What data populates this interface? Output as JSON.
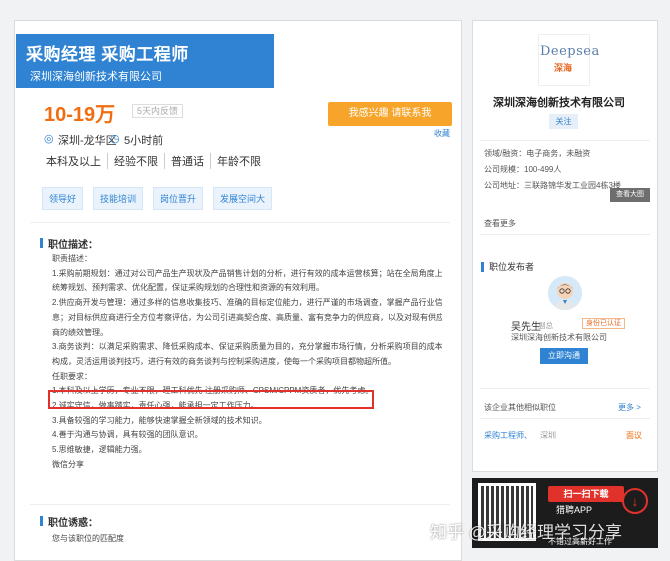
{
  "job": {
    "title": "采购经理 采购工程师",
    "company": "深圳深海创新技术有限公司",
    "salary": "10-19万",
    "feedback": "5天内反馈",
    "interest_button": "我感兴趣 请联系我",
    "collect": "收藏",
    "location": "深圳-龙华区",
    "posted": "5小时前",
    "requirements": [
      "本科及以上",
      "经验不限",
      "普通话",
      "年龄不限"
    ],
    "tags": [
      "领导好",
      "技能培训",
      "岗位晋升",
      "发展空间大"
    ]
  },
  "description": {
    "title": "职位描述：",
    "lines": [
      "职责描述：",
      "1.采购前期规划：通过对公司产品生产现状及产品销售计划的分析，进行有效的成本运营核算；站在全局角度上",
      "统筹规划、预判需求、优化配置，保证采购规划的合理性和资源的有效利用。",
      "2.供应商开发与管理：通过多样的信息收集技巧、准确的目标定位能力，进行严谨的市场调查，掌握产品行业信",
      "息；对目标供应商进行全方位考察评估，为公司引进高契合度、高质量、富有竞争力的供应商，以及对现有供应",
      "商的绩效管理。",
      "3.商务谈判：以满足采购需求、降低采购成本、保证采购质量为目的，充分掌握市场行情，分析采购项目的成本",
      "构成，灵活运用谈判技巧，进行有效的商务谈判与控制采购进度，使每一个采购项目都物超所值。",
      "任职要求：",
      "1.本科及以上学历，专业不限，理工科优先 注册采购师、CPSM/CPPM资质者，优先考虑。",
      "2.诚实守信，做事踏实，责任心强，能承担一定工作压力。",
      "3.具备较强的学习能力，能够快速掌握全新领域的技术知识。",
      "4.善于沟通与协调，具有较强的团队意识。",
      "5.思维敏捷，逻辑能力强。",
      "微信分享"
    ]
  },
  "temptation": {
    "title": "职位诱惑：",
    "text": "您与该职位的匹配度"
  },
  "company_card": {
    "logo_text": "Deepsea",
    "logo_cn": "深海",
    "name": "深圳深海创新技术有限公司",
    "follow": "关注",
    "field": "领域/融资：电子商务，未融资",
    "size": "公司规模：100-499人",
    "address": "公司地址：三联路锦华发工业园4栋3楼",
    "view_map": "查看大图",
    "see_more": "查看更多"
  },
  "publisher": {
    "title": "职位发布者",
    "name": "吴先生",
    "role": "副总",
    "verified": "身份已认证",
    "company": "深圳深海创新技术有限公司",
    "chat_button": "立即沟通"
  },
  "similar": {
    "title": "该企业其他相似职位",
    "more": "更多 >",
    "job": "采购工程师、",
    "city": "深圳",
    "salary": "面议"
  },
  "ad": {
    "scan": "扫一扫下载",
    "app": "猎聘APP",
    "slogan": "不错过高薪好工作"
  },
  "watermark": "知乎 @采购经理学习分享",
  "colors": {
    "accent": "#2f83d2",
    "salary": "#f26d0f",
    "button": "#f6a52a",
    "highlight": "#e0322b"
  }
}
